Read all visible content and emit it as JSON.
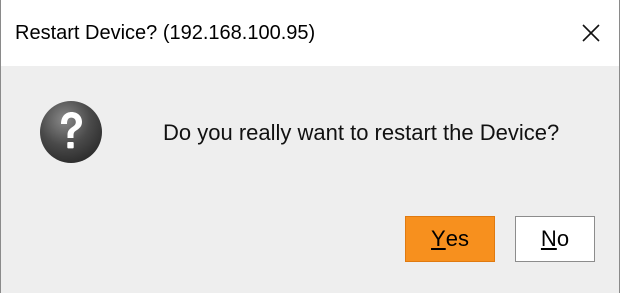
{
  "dialog": {
    "title": "Restart Device? (192.168.100.95)",
    "close_icon": "close-icon",
    "question_icon": "question-mark-icon",
    "message": "Do you really want to restart the Device?",
    "buttons": {
      "yes": {
        "mnemonic": "Y",
        "rest": "es",
        "accent_color": "#F7901E"
      },
      "no": {
        "mnemonic": "N",
        "rest": "o"
      }
    }
  }
}
